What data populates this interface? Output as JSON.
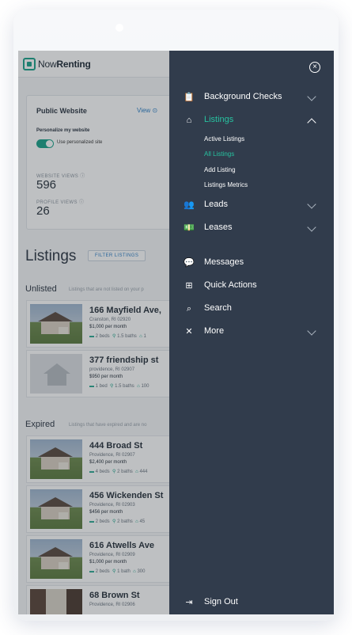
{
  "app": {
    "logo_prefix": "Now",
    "logo_bold": "Renting"
  },
  "website_card": {
    "title": "Public Website",
    "view_link": "View",
    "personalize_label": "Personalize my website",
    "toggle_label": "Use personalized site",
    "website_views_label": "WEBSITE VIEWS",
    "website_views": "596",
    "profile_views_label": "PROFILE VIEWS",
    "profile_views": "26"
  },
  "listings_page": {
    "title": "Listings",
    "filter_button": "FILTER LISTINGS",
    "unlisted_title": "Unlisted",
    "unlisted_sub": "Listings that are not listed on your p",
    "expired_title": "Expired",
    "expired_sub": "Listings that have expired and are no",
    "unlisted": [
      {
        "title": "166 Mayfield Ave,",
        "city": "Cranston, RI 02920",
        "price": "$1,000 per month",
        "beds": "2 beds",
        "baths": "1.5 baths",
        "extra": "1",
        "thumb": "house"
      },
      {
        "title": "377 friendship st",
        "city": "providence, RI 02907",
        "price": "$950 per month",
        "beds": "1 bed",
        "baths": "1.5 baths",
        "extra": "100",
        "thumb": "placeholder"
      }
    ],
    "expired": [
      {
        "title": "444 Broad St",
        "city": "Providence, RI 02907",
        "price": "$2,400 per month",
        "beds": "4 beds",
        "baths": "2 baths",
        "extra": "444",
        "thumb": "house"
      },
      {
        "title": "456 Wickenden St",
        "city": "Providence, RI 02903",
        "price": "$456 per month",
        "beds": "2 beds",
        "baths": "2 baths",
        "extra": "45",
        "thumb": "house"
      },
      {
        "title": "616 Atwells Ave",
        "city": "Providence, RI 02909",
        "price": "$1,000 per month",
        "beds": "2 beds",
        "baths": "1 bath",
        "extra": "300",
        "thumb": "house"
      },
      {
        "title": "68 Brown St",
        "city": "Providence, RI 02906",
        "price": "",
        "beds": "",
        "baths": "",
        "extra": "",
        "thumb": "interior"
      }
    ]
  },
  "menu": {
    "items": [
      {
        "label": "Background Checks",
        "icon": "clipboard-icon",
        "chevron": "down"
      },
      {
        "label": "Listings",
        "icon": "home-icon",
        "chevron": "up",
        "active": true
      },
      {
        "label": "Leads",
        "icon": "people-icon",
        "chevron": "down"
      },
      {
        "label": "Leases",
        "icon": "money-icon",
        "chevron": "down"
      },
      {
        "label": "Messages",
        "icon": "chat-icon"
      },
      {
        "label": "Quick Actions",
        "icon": "plus-icon"
      },
      {
        "label": "Search",
        "icon": "search-icon"
      },
      {
        "label": "More",
        "icon": "tools-icon",
        "chevron": "down"
      }
    ],
    "listings_sub": [
      "Active Listings",
      "All Listings",
      "Add Listing",
      "Listings Metrics"
    ],
    "active_sub": "All Listings",
    "sign_out": "Sign Out",
    "accent_color": "#27c2a0",
    "background_color": "#313c4c"
  }
}
